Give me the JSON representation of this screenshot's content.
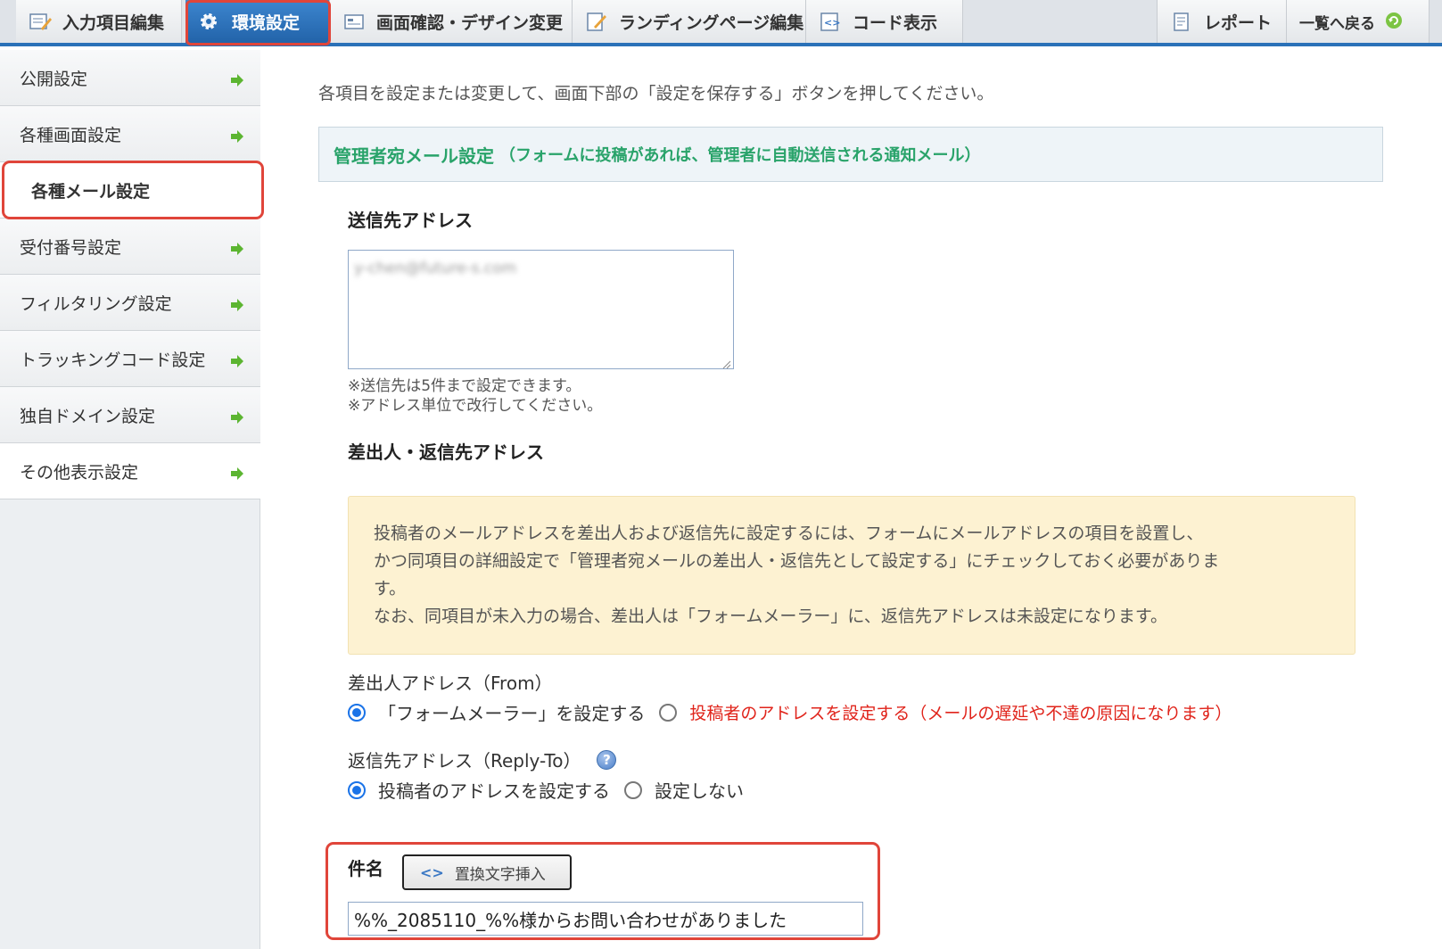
{
  "tabs": [
    {
      "label": "入力項目編集",
      "icon": "edit-form-icon"
    },
    {
      "label": "環境設定",
      "icon": "gear-icon",
      "active": true
    },
    {
      "label": "画面確認・デザイン変更",
      "icon": "screen-icon"
    },
    {
      "label": "ランディングページ編集",
      "icon": "page-edit-icon"
    },
    {
      "label": "コード表示",
      "icon": "code-icon"
    }
  ],
  "right_tabs": {
    "report": "レポート",
    "back": "一覧へ戻る"
  },
  "sidebar": {
    "items": [
      {
        "label": "公開設定"
      },
      {
        "label": "各種画面設定"
      },
      {
        "label": "各種メール設定",
        "active": true
      },
      {
        "label": "受付番号設定"
      },
      {
        "label": "フィルタリング設定"
      },
      {
        "label": "トラッキングコード設定"
      },
      {
        "label": "独自ドメイン設定"
      },
      {
        "label": "その他表示設定"
      }
    ]
  },
  "main": {
    "intro": "各項目を設定または変更して、画面下部の「設定を保存する」ボタンを押してください。",
    "section_title": "管理者宛メール設定",
    "section_sub": "（フォームに投稿があれば、管理者に自動送信される通知メール）",
    "to_label": "送信先アドレス",
    "to_value_blurred": "y-chen@future-s.com",
    "to_note1": "※送信先は5件まで設定できます。",
    "to_note2": "※アドレス単位で改行してください。",
    "sender_heading": "差出人・返信先アドレス",
    "info_line1": "投稿者のメールアドレスを差出人および返信先に設定するには、フォームにメールアドレスの項目を設置し、",
    "info_line2": "かつ同項目の詳細設定で「管理者宛メールの差出人・返信先として設定する」にチェックしておく必要がありま",
    "info_line3": "す。",
    "info_line4": "なお、同項目が未入力の場合、差出人は「フォームメーラー」に、返信先アドレスは未設定になります。",
    "from_label": "差出人アドレス（From）",
    "from_opt1": "「フォームメーラー」を設定する",
    "from_opt2": "投稿者のアドレスを設定する（メールの遅延や不達の原因になります）",
    "reply_label": "返信先アドレス（Reply-To）",
    "reply_opt1": "投稿者のアドレスを設定する",
    "reply_opt2": "設定しない",
    "subject_label": "件名",
    "insert_button": "置換文字挿入",
    "subject_value": "%%_2085110_%%様からお問い合わせがありました"
  },
  "colors": {
    "accent_blue": "#2a71b8",
    "section_green": "#29a36a",
    "warning_red": "#e0241b",
    "highlight_ring": "#e0453a"
  }
}
